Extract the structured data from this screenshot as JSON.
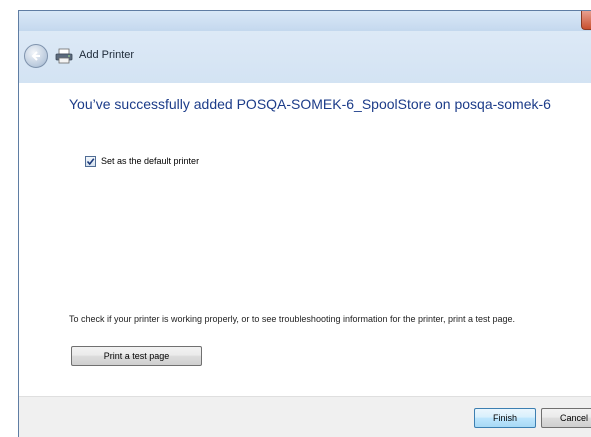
{
  "window": {
    "title": "Add Printer"
  },
  "main": {
    "headline": "You’ve successfully added POSQA-SOMEK-6_SpoolStore on posqa-somek-6",
    "default_printer": {
      "label": "Set as the default printer",
      "checked": true
    },
    "info_text": "To check if your printer is working properly, or to see troubleshooting information for the printer, print a test page.",
    "test_page_button": "Print a test page"
  },
  "footer": {
    "finish_label": "Finish",
    "cancel_label": "Cancel"
  },
  "icons": {
    "back": "back-arrow-icon",
    "printer": "printer-icon",
    "close": "close-icon",
    "check": "checkmark-icon"
  },
  "colors": {
    "headline": "#1c3c89",
    "frame": "#dce8f5",
    "close_button": "#c9502f"
  }
}
